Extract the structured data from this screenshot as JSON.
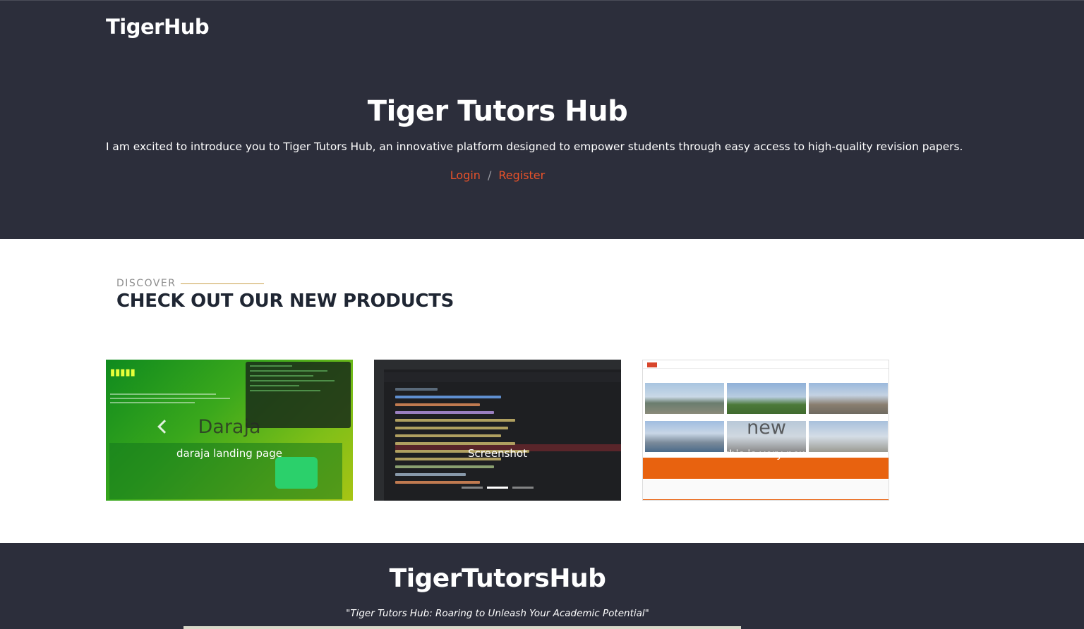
{
  "header": {
    "brand": "TigerHub"
  },
  "hero": {
    "title": "Tiger Tutors Hub",
    "description": "I am excited to introduce you to Tiger Tutors Hub, an innovative platform designed to empower students through easy access to high-quality revision papers.",
    "login_label": "Login",
    "separator": "/",
    "register_label": "Register"
  },
  "products": {
    "eyebrow": "DISCOVER",
    "title": "CHECK OUT OUR NEW PRODUCTS",
    "items": [
      {
        "title": "Daraja",
        "caption": "daraja landing page"
      },
      {
        "title": "",
        "caption": "Screenshot"
      },
      {
        "title": "new",
        "caption": "this is very new"
      }
    ]
  },
  "footer": {
    "title": "TigerTutorsHub",
    "tagline": "\"Tiger Tutors Hub: Roaring to Unleash Your Academic Potential\""
  },
  "colors": {
    "dark_bg": "#2c2e3b",
    "link_accent": "#e8522a",
    "eyebrow_line": "#c9a14a"
  }
}
